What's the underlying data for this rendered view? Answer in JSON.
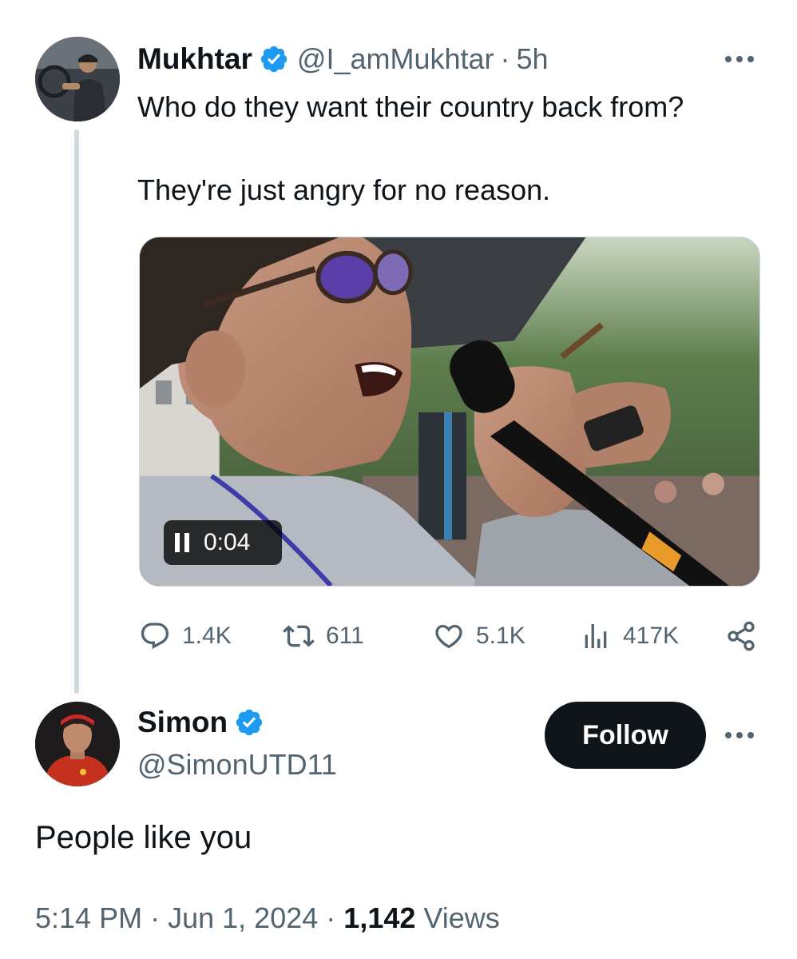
{
  "parent_tweet": {
    "author_name": "Mukhtar",
    "handle": "@I_amMukhtar",
    "separator": "·",
    "time": "5h",
    "text_line1": "Who do they want their country back from?",
    "text_line2": "They're just angry for no reason.",
    "video": {
      "status_icon": "pause-icon",
      "timestamp": "0:04"
    },
    "stats": {
      "replies": "1.4K",
      "reposts": "611",
      "likes": "5.1K",
      "views": "417K"
    }
  },
  "reply_tweet": {
    "author_name": "Simon",
    "handle": "@SimonUTD11",
    "follow_label": "Follow",
    "text": "People like you",
    "time": "5:14 PM",
    "date": "Jun 1, 2024",
    "separator": "·",
    "views_count": "1,142",
    "views_label": "Views"
  },
  "icons": {
    "verified": "verified-badge-icon",
    "more": "more-options-icon",
    "reply": "reply-icon",
    "repost": "repost-icon",
    "like": "heart-icon",
    "views": "views-chart-icon",
    "share": "share-icon"
  },
  "colors": {
    "verified_blue": "#1d9bf0",
    "text_primary": "#0f1419",
    "text_secondary": "#536471",
    "thread_line": "#cfd9de",
    "follow_button_bg": "#0f1419"
  }
}
